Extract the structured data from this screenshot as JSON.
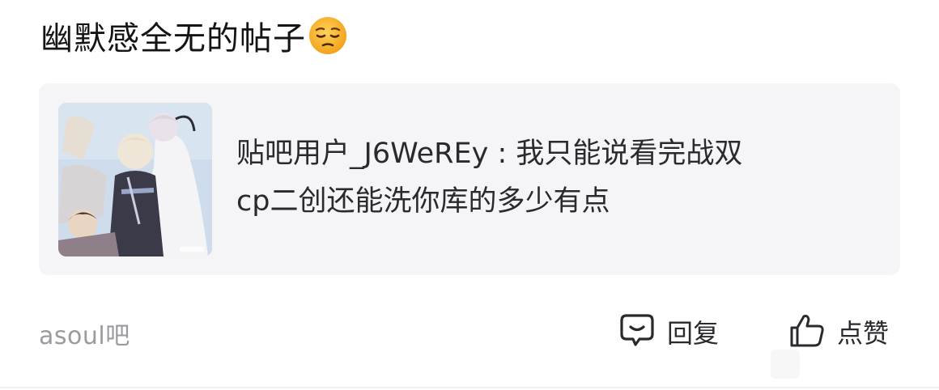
{
  "post": {
    "title": "幽默感全无的帖子",
    "title_emoji": "pensive-face-emoji"
  },
  "quote": {
    "text_line1": "贴吧用户_J6WeREy : 我只能说看完战双",
    "text_line2": "cp二创还能洗你库的多少有点",
    "thumbnail": "anime-illustration-thumbnail"
  },
  "footer": {
    "forum_name": "asoul吧",
    "reply_label": "回复",
    "like_label": "点赞"
  },
  "colors": {
    "card_bg": "#f5f5f7",
    "muted_text": "#9a9aa0",
    "main_text": "#141414"
  }
}
